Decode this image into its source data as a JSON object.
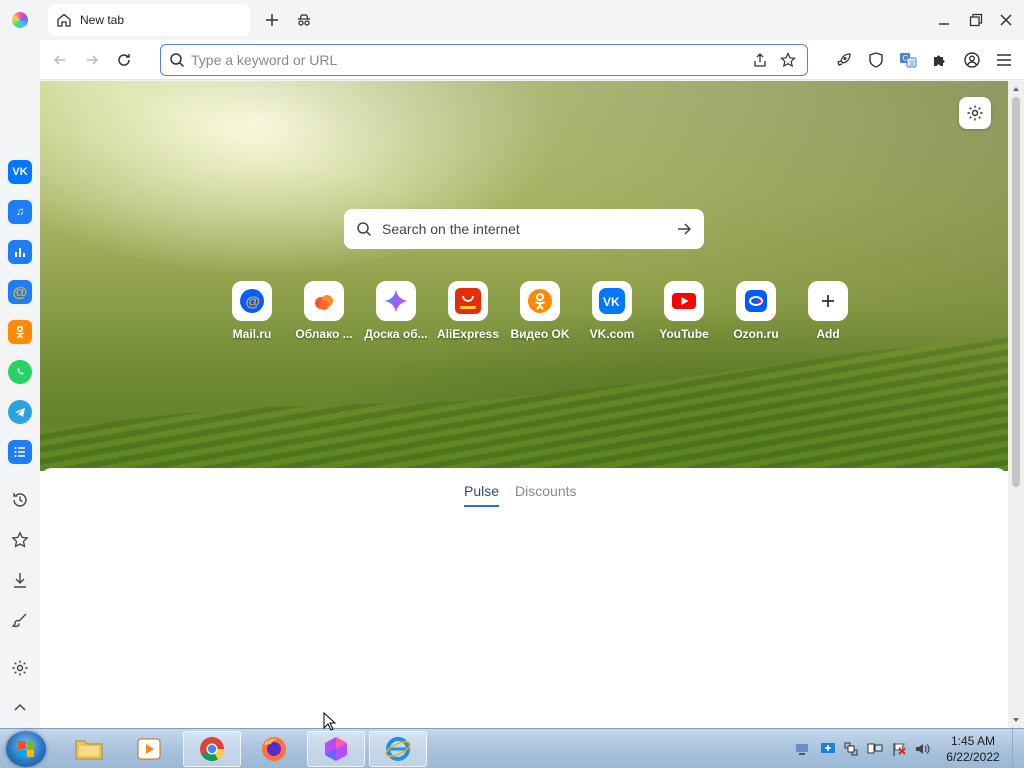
{
  "browser": {
    "tab": {
      "title": "New tab"
    },
    "address_bar": {
      "placeholder": "Type a keyword or URL",
      "value": ""
    }
  },
  "sidebar": {
    "apps": [
      {
        "name": "vk",
        "color": "#0077ff",
        "glyph": "VK"
      },
      {
        "name": "music",
        "color": "#1f7df5",
        "glyph": "♫"
      },
      {
        "name": "stats",
        "color": "#1f7df5",
        "glyph": "▮"
      },
      {
        "name": "mail",
        "color": "#1f7df5",
        "glyph": "@"
      },
      {
        "name": "ok",
        "color": "#ff8a00",
        "glyph": "ок"
      },
      {
        "name": "whatsapp",
        "color": "#25d366",
        "glyph": "✆"
      },
      {
        "name": "telegram",
        "color": "#2aa3e0",
        "glyph": "➤"
      },
      {
        "name": "tasks",
        "color": "#1f7df5",
        "glyph": "☰"
      }
    ]
  },
  "newtab": {
    "search": {
      "placeholder": "Search on the internet"
    },
    "tiles": [
      {
        "label": "Mail.ru",
        "icon": "mailru-icon",
        "color": "#005ff9"
      },
      {
        "label": "Облако ...",
        "icon": "cloud-icon",
        "color": "#ff6a2b"
      },
      {
        "label": "Доска об...",
        "icon": "sparkle-icon",
        "color": "#9b5cff"
      },
      {
        "label": "AliExpress",
        "icon": "aliexpress-icon",
        "color": "#e62e04"
      },
      {
        "label": "Видео OK",
        "icon": "ok-icon",
        "color": "#ff8a00"
      },
      {
        "label": "VK.com",
        "icon": "vk-icon",
        "color": "#0077ff"
      },
      {
        "label": "YouTube",
        "icon": "youtube-icon",
        "color": "#ff0000"
      },
      {
        "label": "Ozon.ru",
        "icon": "ozon-icon",
        "color": "#005bff"
      },
      {
        "label": "Add",
        "icon": "plus-icon",
        "color": "#333333"
      }
    ],
    "feed_tabs": [
      {
        "label": "Pulse",
        "active": true
      },
      {
        "label": "Discounts",
        "active": false
      }
    ]
  },
  "taskbar": {
    "clock": {
      "time": "1:45 AM",
      "date": "6/22/2022"
    },
    "apps": [
      "explorer",
      "media-player",
      "chrome",
      "firefox",
      "atom-browser",
      "internet-explorer"
    ]
  }
}
